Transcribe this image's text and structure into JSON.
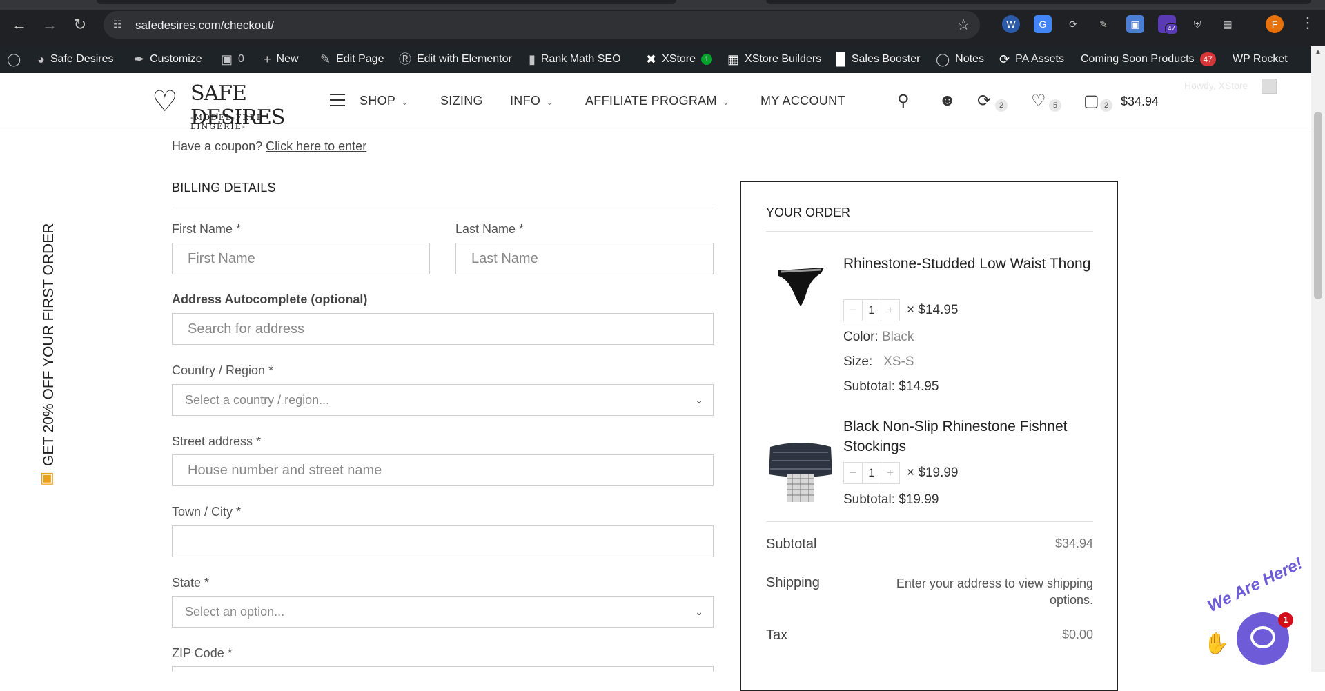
{
  "browser": {
    "url": "safedesires.com/checkout/",
    "profile_initial": "F",
    "ext_badge": "47"
  },
  "wp_admin_bar": {
    "site_name": "Safe Desires",
    "customize": "Customize",
    "comments_count": "0",
    "new": "New",
    "edit_page": "Edit Page",
    "edit_elementor": "Edit with Elementor",
    "rank_math": "Rank Math SEO",
    "xstore": "XStore",
    "xstore_badge": "1",
    "xstore_builders": "XStore Builders",
    "sales_booster": "Sales Booster",
    "notes": "Notes",
    "pa_assets": "PA Assets",
    "coming_soon": "Coming Soon Products",
    "coming_soon_count": "47",
    "wp_rocket": "WP Rocket"
  },
  "header": {
    "logo_name": "SAFE DESIRES",
    "logo_tagline": "-MODEL-FREE LINGERIE-",
    "nav": {
      "shop": "SHOP",
      "sizing": "SIZING",
      "info": "INFO",
      "affiliate": "AFFILIATE PROGRAM",
      "account": "MY ACCOUNT"
    },
    "compare_count": "2",
    "wishlist_count": "5",
    "cart_count": "2",
    "cart_total": "$34.94",
    "howdy": "Howdy, XStore"
  },
  "side_promo": "GET 20% OFF YOUR FIRST ORDER",
  "checkout": {
    "coupon_text": "Have a coupon?",
    "coupon_link": "Click here to enter",
    "billing_title": "BILLING DETAILS",
    "first_name_label": "First Name *",
    "first_name_placeholder": "First Name",
    "last_name_label": "Last Name *",
    "last_name_placeholder": "Last Name",
    "autocomplete_label": "Address Autocomplete (optional)",
    "autocomplete_placeholder": "Search for address",
    "country_label": "Country / Region *",
    "country_placeholder": "Select a country / region...",
    "street_label": "Street address *",
    "street_placeholder": "House number and street name",
    "city_label": "Town / City *",
    "city_value": "",
    "state_label": "State *",
    "state_placeholder": "Select an option...",
    "zip_label": "ZIP Code *"
  },
  "order": {
    "title": "YOUR ORDER",
    "items": [
      {
        "name": "Rhinestone-Studded Low Waist Thong",
        "qty": "1",
        "unit_price": "× $14.95",
        "color_label": "Color:",
        "color_value": "Black",
        "size_label": "Size:",
        "size_value": "XS-S",
        "subtotal": "Subtotal: $14.95"
      },
      {
        "name": "Black Non-Slip Rhinestone Fishnet Stockings",
        "qty": "1",
        "unit_price": "× $19.99",
        "subtotal": "Subtotal: $19.99"
      }
    ],
    "subtotal_label": "Subtotal",
    "subtotal_value": "$34.94",
    "shipping_label": "Shipping",
    "shipping_value": "Enter your address to view shipping options.",
    "tax_label": "Tax",
    "tax_value": "$0.00"
  },
  "chat": {
    "text": "We Are Here!",
    "badge": "1"
  }
}
